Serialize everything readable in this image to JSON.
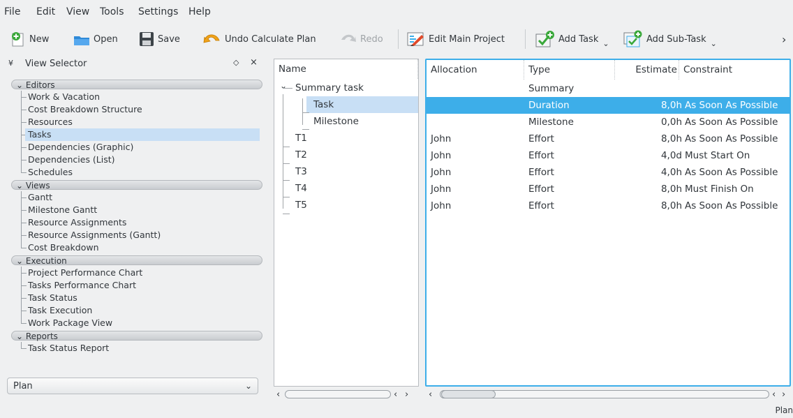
{
  "menu": {
    "file": "File",
    "edit": "Edit",
    "view": "View",
    "tools": "Tools",
    "settings": "Settings",
    "help": "Help"
  },
  "toolbar": {
    "new": "New",
    "open": "Open",
    "save": "Save",
    "undo": "Undo Calculate Plan",
    "redo": "Redo",
    "edit_main_project": "Edit Main Project",
    "add_task": "Add Task",
    "add_subtask": "Add Sub-Task",
    "more": "›"
  },
  "view_selector": {
    "title": "View Selector",
    "categories": [
      {
        "label": "Editors",
        "items": [
          "Work & Vacation",
          "Cost Breakdown Structure",
          "Resources",
          "Tasks",
          "Dependencies (Graphic)",
          "Dependencies (List)",
          "Schedules"
        ]
      },
      {
        "label": "Views",
        "items": [
          "Gantt",
          "Milestone Gantt",
          "Resource Assignments",
          "Resource Assignments (Gantt)",
          "Cost Breakdown"
        ]
      },
      {
        "label": "Execution",
        "items": [
          "Project Performance Chart",
          "Tasks Performance Chart",
          "Task Status",
          "Task Execution",
          "Work Package View"
        ]
      },
      {
        "label": "Reports",
        "items": [
          "Task Status Report"
        ]
      }
    ],
    "selected_item": "Tasks",
    "plan_select": "Plan"
  },
  "tree": {
    "header": "Name",
    "rows": [
      "Summary task",
      "Task",
      "Milestone",
      "T1",
      "T2",
      "T3",
      "T4",
      "T5"
    ]
  },
  "table": {
    "headers": {
      "allocation": "Allocation",
      "type": "Type",
      "estimate": "Estimate",
      "constraint": "Constraint"
    },
    "rows": [
      {
        "allocation": "",
        "type": "Summary",
        "estimate": "",
        "constraint": ""
      },
      {
        "allocation": "",
        "type": "Duration",
        "estimate": "8,0h",
        "constraint": "As Soon As Possible"
      },
      {
        "allocation": "",
        "type": "Milestone",
        "estimate": "0,0h",
        "constraint": "As Soon As Possible"
      },
      {
        "allocation": "John",
        "type": "Effort",
        "estimate": "8,0h",
        "constraint": "As Soon As Possible"
      },
      {
        "allocation": "John",
        "type": "Effort",
        "estimate": "4,0d",
        "constraint": "Must Start On"
      },
      {
        "allocation": "John",
        "type": "Effort",
        "estimate": "4,0h",
        "constraint": "As Soon As Possible"
      },
      {
        "allocation": "John",
        "type": "Effort",
        "estimate": "8,0h",
        "constraint": "Must Finish On"
      },
      {
        "allocation": "John",
        "type": "Effort",
        "estimate": "8,0h",
        "constraint": "As Soon As Possible"
      }
    ]
  },
  "status": {
    "label": "Plan"
  },
  "colors": {
    "accent": "#3daee9",
    "selection_light": "#c8dff5",
    "background": "#eff0f1"
  }
}
